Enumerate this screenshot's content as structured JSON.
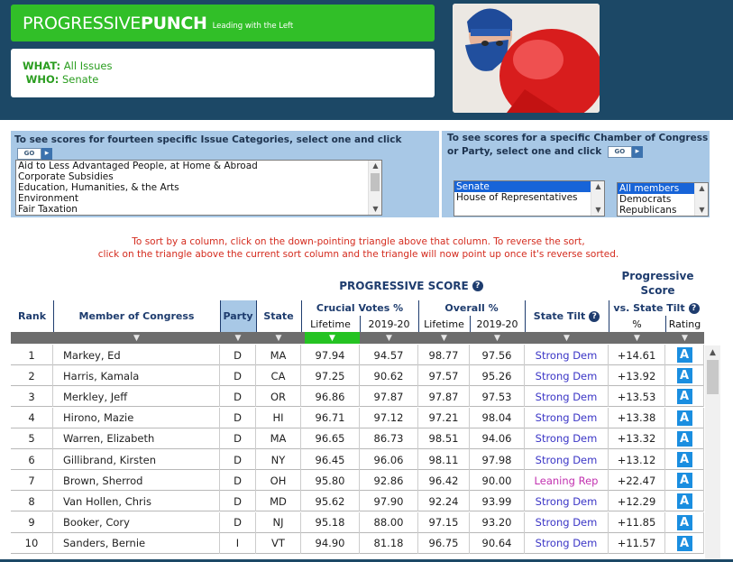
{
  "header": {
    "logo_light": "PROGRESSIVE",
    "logo_bold": "PUNCH",
    "tagline": "Leading with the Left",
    "what_label": "WHAT:",
    "what_value": "All Issues",
    "who_label": "WHO:",
    "who_value": "Senate"
  },
  "issue_panel": {
    "title": "To see scores for fourteen specific Issue Categories, select one and click",
    "go_label": "GO",
    "options": [
      "Aid to Less Advantaged People, at Home & Abroad",
      "Corporate Subsidies",
      "Education, Humanities, & the Arts",
      "Environment",
      "Fair Taxation"
    ]
  },
  "chamber_panel": {
    "title": "To see scores for a specific Chamber of Congress or Party, select one and click",
    "go_label": "GO",
    "chambers": [
      "Senate",
      "House of Representatives"
    ],
    "parties": [
      "All members",
      "Democrats",
      "Republicans"
    ]
  },
  "sort_note": {
    "line1": "To sort by a column, click on the down-pointing triangle above that column. To reverse the sort,",
    "line2": "click on the triangle above the current sort column and the triangle will now point up once it's reverse sorted."
  },
  "table": {
    "group_progressive": "PROGRESSIVE SCORE",
    "group_progressive2_line1": "Progressive",
    "group_progressive2_line2": "Score",
    "headers": {
      "rank": "Rank",
      "member": "Member of Congress",
      "party": "Party",
      "state": "State",
      "crucial": "Crucial Votes %",
      "overall": "Overall %",
      "tilt": "State Tilt",
      "vs_tilt": "vs. State Tilt",
      "lifetime1": "Lifetime",
      "y1": "2019-20",
      "lifetime2": "Lifetime",
      "y2": "2019-20",
      "pct": "%",
      "rating": "Rating"
    },
    "help_glyph": "?",
    "sort_glyph": "▼",
    "rows": [
      {
        "rank": "1",
        "name": "Markey, Ed",
        "party": "D",
        "state": "MA",
        "cl": "97.94",
        "cy": "94.57",
        "ol": "98.77",
        "oy": "97.56",
        "tilt": "Strong Dem",
        "vs": "+14.61",
        "rating": "A"
      },
      {
        "rank": "2",
        "name": "Harris, Kamala",
        "party": "D",
        "state": "CA",
        "cl": "97.25",
        "cy": "90.62",
        "ol": "97.57",
        "oy": "95.26",
        "tilt": "Strong Dem",
        "vs": "+13.92",
        "rating": "A"
      },
      {
        "rank": "3",
        "name": "Merkley, Jeff",
        "party": "D",
        "state": "OR",
        "cl": "96.86",
        "cy": "97.87",
        "ol": "97.87",
        "oy": "97.53",
        "tilt": "Strong Dem",
        "vs": "+13.53",
        "rating": "A"
      },
      {
        "rank": "4",
        "name": "Hirono, Mazie",
        "party": "D",
        "state": "HI",
        "cl": "96.71",
        "cy": "97.12",
        "ol": "97.21",
        "oy": "98.04",
        "tilt": "Strong Dem",
        "vs": "+13.38",
        "rating": "A"
      },
      {
        "rank": "5",
        "name": "Warren, Elizabeth",
        "party": "D",
        "state": "MA",
        "cl": "96.65",
        "cy": "86.73",
        "ol": "98.51",
        "oy": "94.06",
        "tilt": "Strong Dem",
        "vs": "+13.32",
        "rating": "A"
      },
      {
        "rank": "6",
        "name": "Gillibrand, Kirsten",
        "party": "D",
        "state": "NY",
        "cl": "96.45",
        "cy": "96.06",
        "ol": "98.11",
        "oy": "97.98",
        "tilt": "Strong Dem",
        "vs": "+13.12",
        "rating": "A"
      },
      {
        "rank": "7",
        "name": "Brown, Sherrod",
        "party": "D",
        "state": "OH",
        "cl": "95.80",
        "cy": "92.86",
        "ol": "96.42",
        "oy": "90.00",
        "tilt": "Leaning Rep",
        "vs": "+22.47",
        "rating": "A"
      },
      {
        "rank": "8",
        "name": "Van Hollen, Chris",
        "party": "D",
        "state": "MD",
        "cl": "95.62",
        "cy": "97.90",
        "ol": "92.24",
        "oy": "93.99",
        "tilt": "Strong Dem",
        "vs": "+12.29",
        "rating": "A"
      },
      {
        "rank": "9",
        "name": "Booker, Cory",
        "party": "D",
        "state": "NJ",
        "cl": "95.18",
        "cy": "88.00",
        "ol": "97.15",
        "oy": "93.20",
        "tilt": "Strong Dem",
        "vs": "+11.85",
        "rating": "A"
      },
      {
        "rank": "10",
        "name": "Sanders, Bernie",
        "party": "I",
        "state": "VT",
        "cl": "94.90",
        "cy": "81.18",
        "ol": "96.75",
        "oy": "90.64",
        "tilt": "Strong Dem",
        "vs": "+11.57",
        "rating": "A"
      }
    ]
  },
  "colors": {
    "header_bg": "#1c4866",
    "brand_green": "#31bf28",
    "panel_blue": "#a8c8e6",
    "active_sort": "#25c323",
    "dem_tilt": "#3a35c6",
    "rep_tilt": "#c232b0",
    "rating_blue": "#1a8ee0"
  }
}
